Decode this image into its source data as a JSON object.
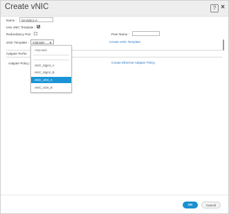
{
  "dialog": {
    "title": "Create vNIC"
  },
  "form": {
    "name_label": "Name :",
    "name_value": "02-vNIC1-A",
    "use_template_label": "Use vNIC Template :",
    "use_template_checked": true,
    "redundancy_label": "Redundancy Pair :",
    "redundancy_checked": false,
    "peer_name_label": "Peer Name :",
    "peer_name_value": "",
    "template_label": "vNIC Template :",
    "template_value": "<not set>",
    "create_template_link": "Create vNIC Template",
    "adapter_section_label": "Adapter Perfor",
    "adapter_policy_label": "Adapter Policy :",
    "create_adapter_link": "Create Ethernet Adapter Policy"
  },
  "dropdown": {
    "items": [
      {
        "label": "<not set>",
        "selected": false
      },
      {
        "label": "vNIC_Mgmt_A",
        "selected": false
      },
      {
        "label": "vNIC_Mgmt_B",
        "selected": false
      },
      {
        "label": "vNIC_vDS_A",
        "selected": true
      },
      {
        "label": "vNIC_vDS_B",
        "selected": false
      }
    ]
  },
  "footer": {
    "ok_label": "OK",
    "cancel_label": "Cancel"
  }
}
